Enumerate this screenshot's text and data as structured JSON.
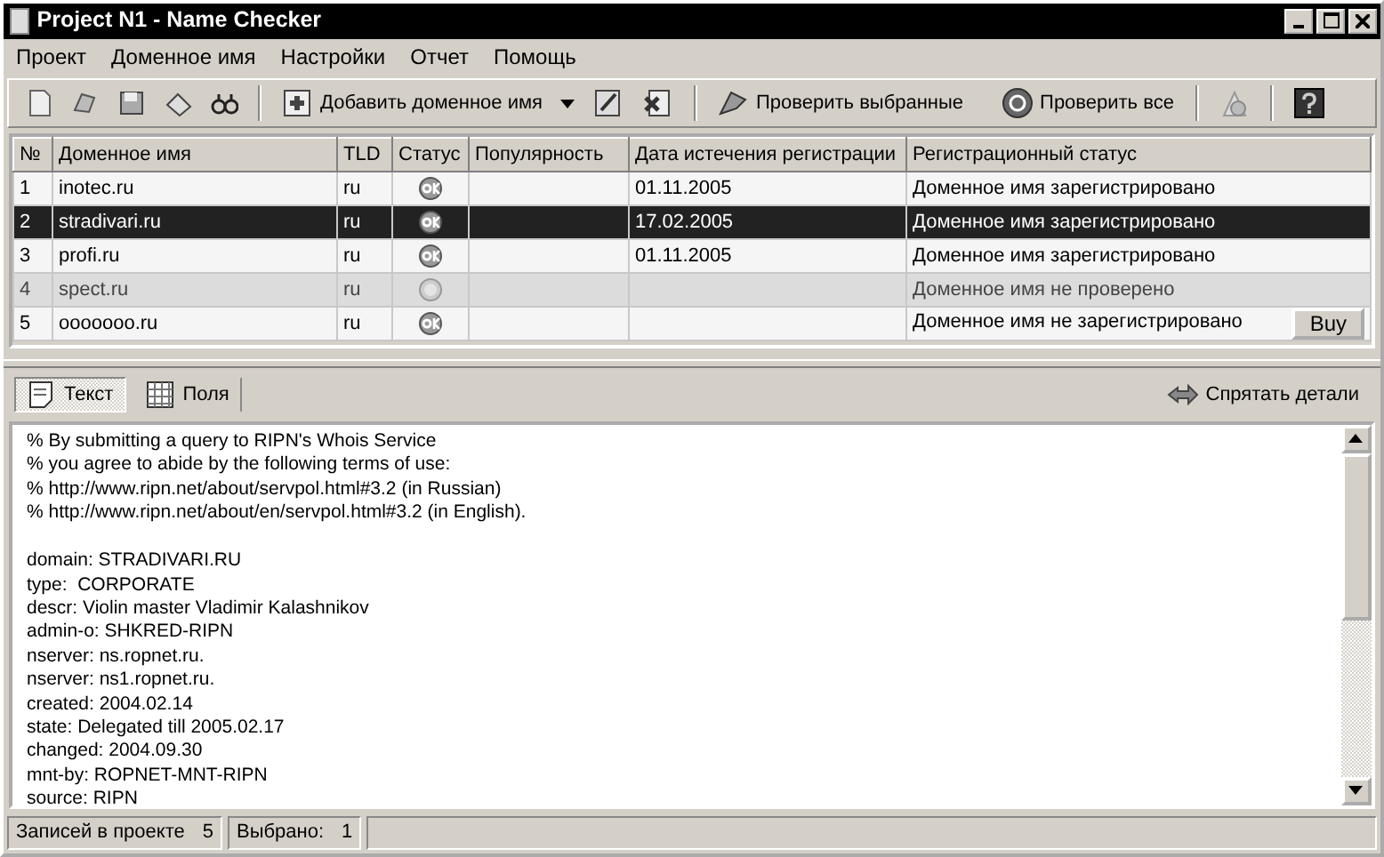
{
  "window": {
    "title": "Project N1 - Name Checker"
  },
  "menu": [
    "Проект",
    "Доменное имя",
    "Настройки",
    "Отчет",
    "Помощь"
  ],
  "toolbar": {
    "add_label": "Добавить доменное имя",
    "check_selected_label": "Проверить выбранные",
    "check_all_label": "Проверить все"
  },
  "table": {
    "columns": [
      "№",
      "Доменное имя",
      "TLD",
      "Статус",
      "Популярность",
      "Дата истечения регистрации",
      "Регистрационный статус"
    ],
    "rows": [
      {
        "n": "1",
        "domain": "inotec.ru",
        "tld": "ru",
        "kind": "ok",
        "expires": "01.11.2005",
        "reg_status": "Доменное имя зарегистрировано",
        "selected": false
      },
      {
        "n": "2",
        "domain": "stradivari.ru",
        "tld": "ru",
        "kind": "ok",
        "expires": "17.02.2005",
        "reg_status": "Доменное имя зарегистрировано",
        "selected": true
      },
      {
        "n": "3",
        "domain": "profi.ru",
        "tld": "ru",
        "kind": "ok",
        "expires": "01.11.2005",
        "reg_status": "Доменное имя зарегистрировано",
        "selected": false
      },
      {
        "n": "4",
        "domain": "spect.ru",
        "tld": "ru",
        "kind": "unchecked",
        "reg_status": "Доменное имя не проверено",
        "selected": false
      },
      {
        "n": "5",
        "domain": "ooooooo.ru",
        "tld": "ru",
        "kind": "ok",
        "reg_status": "Доменное имя не зарегистрировано",
        "action": "Buy",
        "selected": false
      }
    ]
  },
  "detail_tabs": [
    {
      "label": "Текст",
      "selected": true
    },
    {
      "label": "Поля",
      "selected": false
    }
  ],
  "hide_details": "Спрятать детали",
  "whois_text": {
    "notice": [
      "% By submitting a query to RIPN's Whois Service",
      "% you agree to abide by the following terms of use:",
      "% http://www.ripn.net/about/servpol.html#3.2 (in Russian)",
      "% http://www.ripn.net/about/en/servpol.html#3.2 (in English)."
    ],
    "record": [
      "domain: STRADIVARI.RU",
      "type:  CORPORATE",
      "descr: Violin master Vladimir Kalashnikov",
      "admin-o: SHKRED-RIPN",
      "nserver: ns.ropnet.ru.",
      "nserver: ns1.ropnet.ru.",
      "created: 2004.02.14",
      "state: Delegated till 2005.02.17",
      "changed: 2004.09.30",
      "mnt-by: ROPNET-MNT-RIPN",
      "source: RIPN"
    ]
  },
  "status_bar": {
    "records_label": "Записей в проекте",
    "records_value": "5",
    "selected_label": "Выбрано:",
    "selected_value": "1"
  }
}
